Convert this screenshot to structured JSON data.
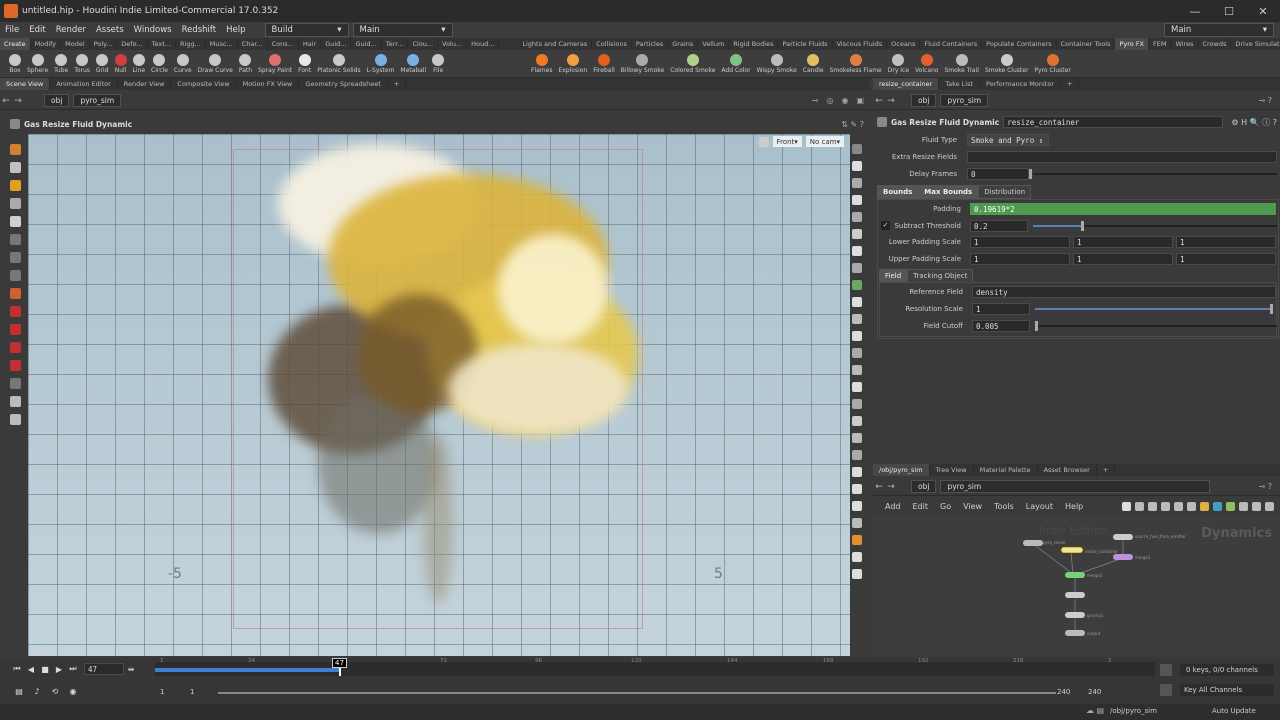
{
  "window": {
    "title": "untitled.hip - Houdini Indie Limited-Commercial 17.0.352",
    "controls": [
      "—",
      "☐",
      "✕"
    ]
  },
  "menubar": {
    "items": [
      "File",
      "Edit",
      "Render",
      "Assets",
      "Windows",
      "Redshift",
      "Help"
    ],
    "desktop": "Build",
    "desktop_right": "Main",
    "desktop_main": "Main"
  },
  "shelf_tabs_left": [
    "Create",
    "Modify",
    "Model",
    "Poly...",
    "Defo...",
    "Text...",
    "Rigg...",
    "Musc...",
    "Char...",
    "Cons...",
    "Hair",
    "Guid...",
    "Guid...",
    "Terr...",
    "Clou...",
    "Volu...",
    "Houd..."
  ],
  "shelf_tabs_right": [
    "Lights and Cameras",
    "Collisions",
    "Particles",
    "Grains",
    "Vellum",
    "Rigid Bodies",
    "Particle Fluids",
    "Viscous Fluids",
    "Oceans",
    "Fluid Containers",
    "Populate Containers",
    "Container Tools",
    "Pyro FX",
    "FEM",
    "Wires",
    "Crowds",
    "Drive Simulation"
  ],
  "tools_left": [
    "Box",
    "Sphere",
    "Tube",
    "Torus",
    "Grid",
    "Null",
    "Line",
    "Circle",
    "Curve",
    "Draw Curve",
    "Path",
    "Spray Paint",
    "Font",
    "Platonic Solids",
    "L-System",
    "Metaball",
    "File"
  ],
  "tools_right": [
    "Flames",
    "Explosion",
    "Fireball",
    "Billowy Smoke",
    "Colored Smoke",
    "Add Color",
    "Wispy Smoke",
    "Candle",
    "Smokeless Flame",
    "Dry Ice",
    "Volcano",
    "Smoke Trail",
    "Smoke Cluster",
    "Pyro Cluster"
  ],
  "colors": {
    "tools_left": [
      "#c8c8c8",
      "#c8c8c8",
      "#c8c8c8",
      "#c8c8c8",
      "#c8c8c8",
      "#d04040",
      "#c8c8c8",
      "#c8c8c8",
      "#c8c8c8",
      "#c8c8c8",
      "#c8c8c8",
      "#e07070",
      "#e8e8e8",
      "#c8c8c8",
      "#7ab0e0",
      "#7ab0e0",
      "#c8c8c8"
    ],
    "tools_right": [
      "#f07a20",
      "#f0a040",
      "#e06020",
      "#aaaaaa",
      "#b0d090",
      "#80c080",
      "#bbbbbb",
      "#e0c060",
      "#e08040",
      "#c0c0c0",
      "#e06030",
      "#bbbbbb",
      "#cccccc",
      "#e07030"
    ],
    "left_tools": [
      "#d08030",
      "#c0c0c0",
      "#e0a020",
      "#aaa",
      "#d0d0d0",
      "#777",
      "#777",
      "#777",
      "#d06030",
      "#c03030",
      "#c03030",
      "#c03030",
      "#c03030",
      "#777",
      "#bbb",
      "#bbb"
    ],
    "right_tools": [
      "#888",
      "#ddd",
      "#aaa",
      "#ddd",
      "#aaa",
      "#ccc",
      "#ddd",
      "#aaa",
      "#6a6",
      "#ddd",
      "#bbb",
      "#ddd",
      "#aaa",
      "#bbb",
      "#ddd",
      "#aaa",
      "#ccc",
      "#bbb",
      "#aaa",
      "#ddd",
      "#ddd",
      "#ddd",
      "#bbb",
      "#e09030",
      "#ddd",
      "#ddd"
    ],
    "net_toolbar": [
      "#ddd",
      "#bbb",
      "#bbb",
      "#bbb",
      "#bbb",
      "#bbb",
      "#e0b040",
      "#40a0c0",
      "#90c060",
      "#bbb",
      "#bbb",
      "#bbb"
    ],
    "accent_green": "#4e9a4e"
  },
  "viewer": {
    "pane_tabs": [
      "Scene View",
      "Animation Editor",
      "Render View",
      "Composite View",
      "Motion FX View",
      "Geometry Spreadsheet"
    ],
    "path": [
      "obj",
      "pyro_sim"
    ],
    "node_title": "Gas Resize Fluid Dynamic",
    "camera_view": "Front",
    "camera": "No cam",
    "grid_labels": [
      "-5",
      "5"
    ]
  },
  "params": {
    "pane_tabs": [
      "resize_container",
      "Take List",
      "Performance Monitor"
    ],
    "path": [
      "obj",
      "pyro_sim"
    ],
    "node_type": "Gas Resize Fluid Dynamic",
    "node_name": "resize_container",
    "fluid_type_label": "Fluid Type",
    "fluid_type_value": "Smoke and Pyro",
    "extra_fields_label": "Extra Resize Fields",
    "delay_label": "Delay Frames",
    "delay_value": "0",
    "tabs": [
      "Bounds",
      "Max Bounds",
      "Distribution"
    ],
    "padding_label": "Padding",
    "padding_value": "0.19619*2",
    "subtract_label": "Subtract Threshold",
    "subtract_value": "0.2",
    "lower_label": "Lower Padding Scale",
    "lower_values": [
      "1",
      "1",
      "1"
    ],
    "upper_label": "Upper Padding Scale",
    "upper_values": [
      "1",
      "1",
      "1"
    ],
    "subtabs": [
      "Field",
      "Tracking Object"
    ],
    "ref_label": "Reference Field",
    "ref_value": "density",
    "res_label": "Resolution Scale",
    "res_value": "1",
    "cutoff_label": "Field Cutoff",
    "cutoff_value": "0.005"
  },
  "network": {
    "pane_tabs": [
      "/obj/pyro_sim",
      "Tree View",
      "Material Palette",
      "Asset Browser"
    ],
    "path": [
      "obj",
      "pyro_sim"
    ],
    "menu": [
      "Add",
      "Edit",
      "Go",
      "View",
      "Tools",
      "Layout",
      "Help"
    ],
    "watermark": "Indie Edition",
    "context": "Dynamics",
    "node_labels": [
      "pyro_solver",
      "resize_container",
      "source_fuel_from_emitter",
      "merge1",
      "merge2",
      "gravity1",
      "output"
    ]
  },
  "timeline": {
    "current_frame": "47",
    "ticks": [
      "1",
      "24",
      "47",
      "72",
      "96",
      "120",
      "144",
      "168",
      "192",
      "216",
      "2"
    ],
    "start": "1",
    "range_start": "1",
    "range_end": "240",
    "end": "240",
    "keys_info": "0 keys, 0/0 channels",
    "key_all": "Key All Channels",
    "status_path": "/obj/pyro_sim",
    "update_mode": "Auto Update"
  }
}
